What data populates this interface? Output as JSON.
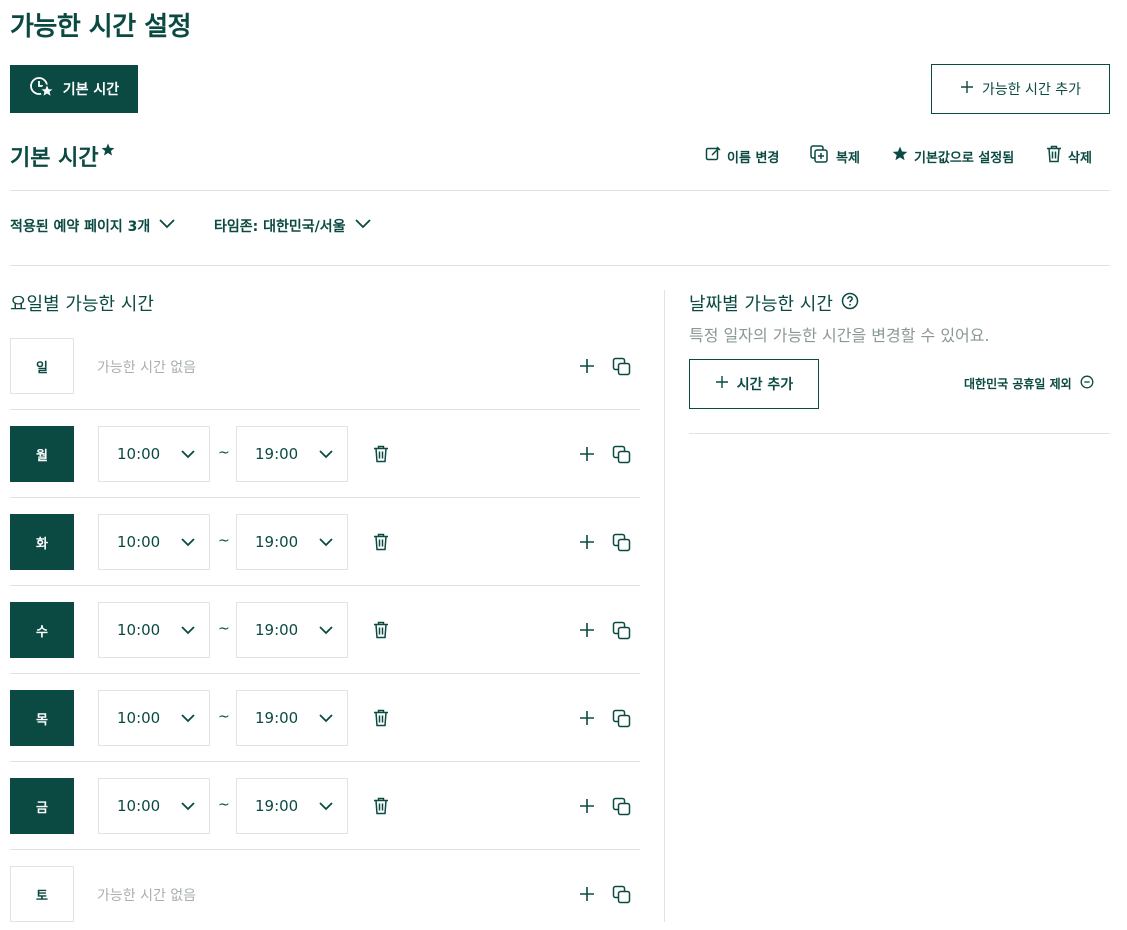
{
  "page": {
    "title": "가능한 시간 설정"
  },
  "top_buttons": {
    "default_label": "기본 시간",
    "add_schedule_label": "가능한 시간 추가"
  },
  "schedule": {
    "title": "기본 시간",
    "actions": {
      "rename": "이름 변경",
      "duplicate": "복제",
      "set_default": "기본값으로 설정됨",
      "delete": "삭제"
    }
  },
  "filters": {
    "pages": "적용된 예약 페이지 3개",
    "timezone": "타임존: 대한민국/서울"
  },
  "weekly": {
    "title": "요일별 가능한 시간",
    "no_time_label": "가능한 시간 없음",
    "days": [
      {
        "label": "일",
        "active": false
      },
      {
        "label": "월",
        "active": true,
        "start": "10:00",
        "end": "19:00"
      },
      {
        "label": "화",
        "active": true,
        "start": "10:00",
        "end": "19:00"
      },
      {
        "label": "수",
        "active": true,
        "start": "10:00",
        "end": "19:00"
      },
      {
        "label": "목",
        "active": true,
        "start": "10:00",
        "end": "19:00"
      },
      {
        "label": "금",
        "active": true,
        "start": "10:00",
        "end": "19:00"
      },
      {
        "label": "토",
        "active": false
      }
    ],
    "separator": "~"
  },
  "date_specific": {
    "title": "날짜별 가능한 시간",
    "subtitle": "특정 일자의 가능한 시간을 변경할 수 있어요.",
    "add_label": "시간 추가",
    "holiday_label": "대한민국 공휴일 제외"
  },
  "colors": {
    "brand": "#0b4a42",
    "border": "#e3e3e3",
    "muted": "#a9b0ae"
  }
}
